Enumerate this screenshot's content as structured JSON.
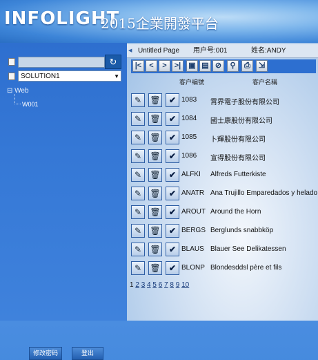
{
  "header": {
    "logo": "INFOLIGHT",
    "title": "2015企業開發平台"
  },
  "sidebar": {
    "user_input": "",
    "go_icon": "refresh-arrow-icon",
    "solution": "SOLUTION1",
    "tree": {
      "root": "Web",
      "child": "W001"
    },
    "change_password": "修改密码",
    "logout": "登出"
  },
  "info": {
    "page": "Untitled Page",
    "user_id": "用户号:001",
    "user_name": "姓名:ANDY"
  },
  "toolbar": [
    "first-icon",
    "prev-icon",
    "next-icon",
    "last-icon",
    "open-icon",
    "save-icon",
    "cancel-icon",
    "search-icon",
    "print-icon",
    "export-icon"
  ],
  "table": {
    "headers": [
      "客户编號",
      "客户名稱"
    ],
    "rows": [
      {
        "id": "1083",
        "name": "霄界電子股份有限公司"
      },
      {
        "id": "1084",
        "name": "國士康股份有限公司"
      },
      {
        "id": "1085",
        "name": "卜輝股份有限公司"
      },
      {
        "id": "1086",
        "name": "宣得股份有限公司"
      },
      {
        "id": "ALFKI",
        "name": "Alfreds Futterkiste"
      },
      {
        "id": "ANATR",
        "name": "Ana Trujillo Emparedados y helados"
      },
      {
        "id": "AROUT",
        "name": "Around the Horn"
      },
      {
        "id": "BERGS",
        "name": "Berglunds snabbköp"
      },
      {
        "id": "BLAUS",
        "name": "Blauer See Delikatessen"
      },
      {
        "id": "BLONP",
        "name": "Blondesddsl père et fils"
      }
    ]
  },
  "pager": [
    "1",
    "2",
    "3",
    "4",
    "5",
    "6",
    "7",
    "8",
    "9",
    "10"
  ]
}
